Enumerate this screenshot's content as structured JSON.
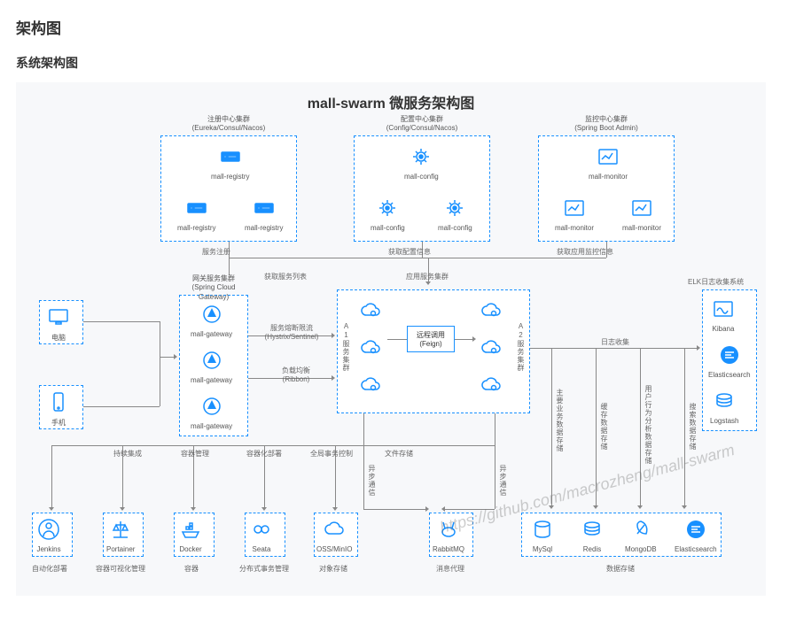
{
  "page": {
    "heading": "架构图",
    "subheading": "系统架构图"
  },
  "diagram": {
    "title": "mall-swarm 微服务架构图",
    "watermark": "https://github.com/macrozheng/mall-swarm",
    "clusters": {
      "registry": {
        "title_cn": "注册中心集群",
        "title_en": "(Eureka/Consul/Nacos)",
        "nodes": [
          "mall-registry",
          "mall-registry",
          "mall-registry"
        ]
      },
      "config": {
        "title_cn": "配置中心集群",
        "title_en": "(Config/Consul/Nacos)",
        "nodes": [
          "mall-config",
          "mall-config",
          "mall-config"
        ]
      },
      "monitor": {
        "title_cn": "监控中心集群",
        "title_en": "(Spring Boot Admin)",
        "nodes": [
          "mall-monitor",
          "mall-monitor",
          "mall-monitor"
        ]
      },
      "gateway": {
        "title_cn": "网关服务集群",
        "title_en": "(Spring Cloud Gateway)",
        "nodes": [
          "mall-gateway",
          "mall-gateway",
          "mall-gateway"
        ]
      },
      "svc_a1": {
        "label": "A1服务集群"
      },
      "svc_a2": {
        "label": "A2服务集群"
      },
      "elk": {
        "title": "ELK日志收集系统",
        "nodes": [
          "Kibana",
          "Elasticsearch",
          "Logstash"
        ]
      }
    },
    "clients": {
      "pc": "电脑",
      "mobile": "手机"
    },
    "mid_labels": {
      "hystrix": {
        "line1": "服务熔断限流",
        "line2": "(Hystrix/Sentinel)"
      },
      "ribbon": {
        "line1": "负载均衡",
        "line2": "(Ribbon)"
      },
      "feign": {
        "line1": "远程调用",
        "line2": "(Feign)"
      }
    },
    "edge_labels": {
      "svc_reg": "服务注册",
      "get_config": "获取配置信息",
      "get_monitor": "获取应用监控信息",
      "get_svc_list": "获取服务列表",
      "app_cluster": "应用服务集群",
      "log_collect": "日志收集",
      "async_l": "异步通信",
      "async_r": "异步通信"
    },
    "vcols": [
      "主要业务数据存储",
      "缓存数据存储",
      "用户行为分析数据存储",
      "搜索数据存储"
    ],
    "tools_row": {
      "labels": [
        "持续集成",
        "容器管理",
        "容器化部署",
        "全局事务控制",
        "文件存储"
      ],
      "nodes": [
        "Jenkins",
        "Portainer",
        "Docker",
        "Seata",
        "OSS/MinIO"
      ],
      "captions": [
        "自动化部署",
        "容器可视化管理",
        "容器",
        "分布式事务管理",
        "对象存储"
      ]
    },
    "mq": {
      "name": "RabbitMQ",
      "caption": "消息代理"
    },
    "db_row": {
      "nodes": [
        "MySql",
        "Redis",
        "MongoDB",
        "Elasticsearch"
      ],
      "caption": "数据存储"
    }
  }
}
